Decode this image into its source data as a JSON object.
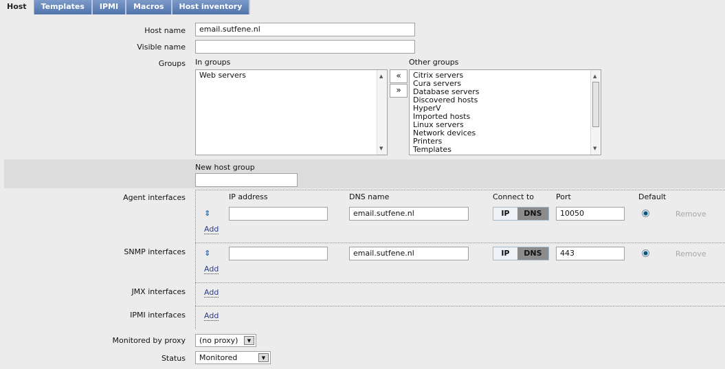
{
  "tabs": [
    "Host",
    "Templates",
    "IPMI",
    "Macros",
    "Host inventory"
  ],
  "form": {
    "host_name_label": "Host name",
    "host_name": "email.sutfene.nl",
    "visible_name_label": "Visible name",
    "visible_name": "",
    "groups_label": "Groups",
    "in_groups_label": "In groups",
    "other_groups_label": "Other groups",
    "in_groups": [
      "Web servers"
    ],
    "other_groups": [
      "Citrix servers",
      "Cura servers",
      "Database servers",
      "Discovered hosts",
      "HyperV",
      "Imported hosts",
      "Linux servers",
      "Network devices",
      "Printers",
      "Templates"
    ],
    "move_left": "«",
    "move_right": "»",
    "new_group_label": "New host group",
    "new_group": "",
    "agent_label": "Agent interfaces",
    "snmp_label": "SNMP interfaces",
    "jmx_label": "JMX interfaces",
    "ipmi_label": "IPMI interfaces",
    "cols": {
      "ip": "IP address",
      "dns": "DNS name",
      "connect": "Connect to",
      "port": "Port",
      "default": "Default"
    },
    "agent": {
      "ip": "",
      "dns": "email.sutfene.nl",
      "port": "10050"
    },
    "snmp": {
      "ip": "",
      "dns": "email.sutfene.nl",
      "port": "443"
    },
    "ip_btn": "IP",
    "dns_btn": "DNS",
    "remove": "Remove",
    "add": "Add",
    "proxy_label": "Monitored by proxy",
    "proxy": "(no proxy)",
    "status_label": "Status",
    "status": "Monitored"
  }
}
